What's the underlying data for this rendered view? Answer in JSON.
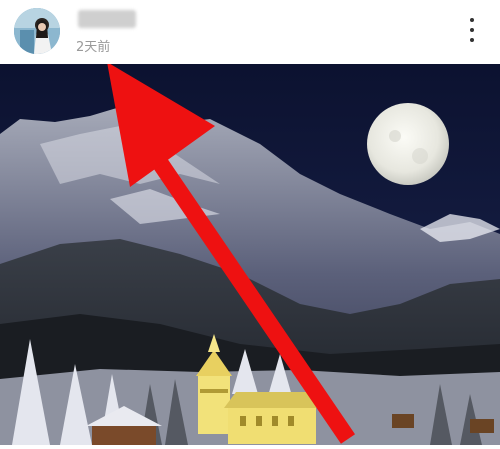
{
  "post": {
    "username": "",
    "time": "2天前",
    "avatar_icon": "avatar-icon",
    "more_icon": "more-vertical-icon"
  },
  "photo": {
    "subject": "night-winter-village-scene"
  },
  "annotation": {
    "arrow_color": "#ee1111"
  }
}
